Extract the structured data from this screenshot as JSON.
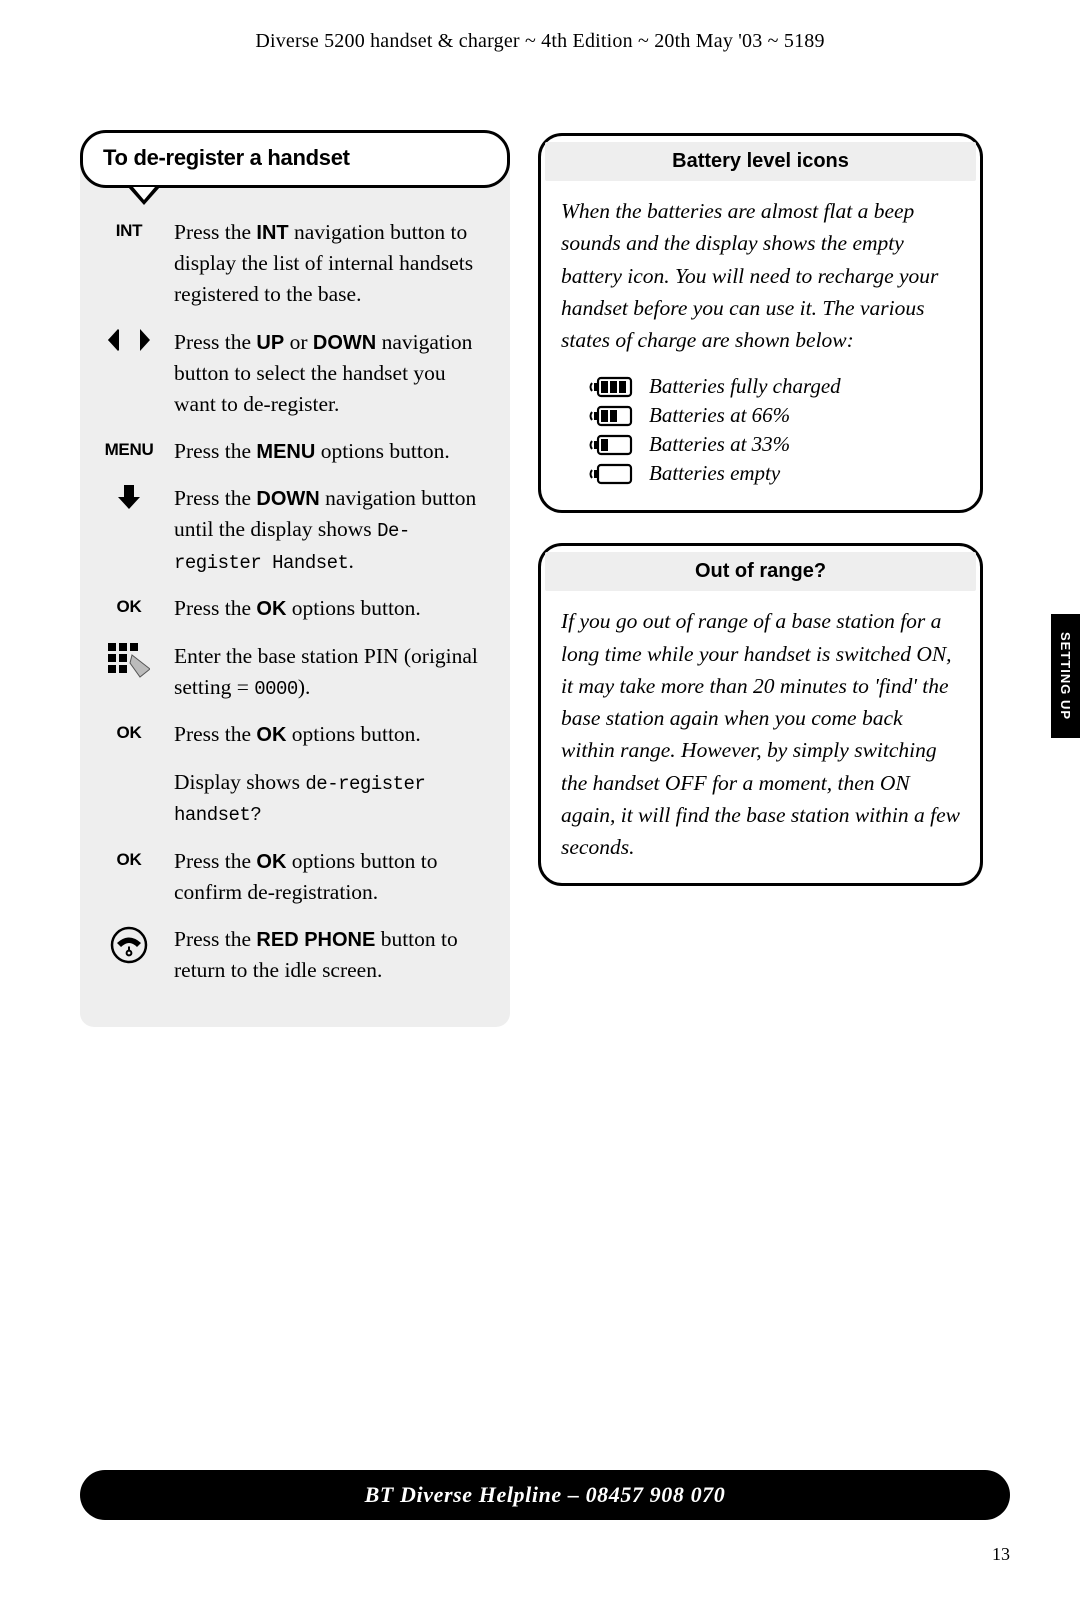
{
  "header": "Diverse 5200 handset & charger ~ 4th Edition ~ 20th May '03 ~ 5189",
  "left": {
    "title": "To de-register a handset",
    "steps": [
      {
        "label": "INT",
        "html": "Press the <span class='b'>INT</span> navigation button to display the list of internal handsets registered to the base."
      },
      {
        "icon": "updown",
        "html": "Press the <span class='b'>UP</span> or <span class='b'>DOWN</span> navigation button to select the handset you want to de-register."
      },
      {
        "label": "MENU",
        "html": "Press the <span class='b'>MENU</span> options button."
      },
      {
        "icon": "down",
        "html": "Press the <span class='b'>DOWN</span> navigation button until the display shows <span class='mono'>De-register Handset</span>."
      },
      {
        "label": "OK",
        "html": "Press the <span class='b'>OK</span> options button."
      },
      {
        "icon": "keypad",
        "html": "Enter the base station PIN (original setting = <span class='mono'>0000</span>)."
      },
      {
        "label": "OK",
        "html": "Press the <span class='b'>OK</span> options button."
      },
      {
        "label": "",
        "html": "Display shows <span class='mono'>de-register handset?</span>"
      },
      {
        "label": "OK",
        "html": "Press the <span class='b'>OK</span> options button to confirm de-registration."
      },
      {
        "icon": "phone",
        "html": "Press the <span class='b'>RED PHONE</span> button to return to the idle screen."
      }
    ]
  },
  "battery": {
    "title": "Battery level icons",
    "intro": "When the batteries are almost flat a beep sounds and the display shows the empty battery icon.  You will need to recharge your handset before you can use it. The various states of charge are shown below:",
    "levels": [
      {
        "bars": 3,
        "text": "Batteries fully charged"
      },
      {
        "bars": 2,
        "text": "Batteries at 66%"
      },
      {
        "bars": 1,
        "text": "Batteries at 33%"
      },
      {
        "bars": 0,
        "text": "Batteries empty"
      }
    ]
  },
  "range": {
    "title": "Out of range?",
    "body": "If you go out of range of a base station for a long time while your handset is switched ON, it may take more than 20 minutes to 'find' the base station again when you come back within range. However, by simply switching the handset OFF for a moment, then ON again, it will find the base station within a few seconds."
  },
  "sideTab": "SETTING UP",
  "footer": "BT Diverse Helpline – 08457 908 070",
  "pageNum": "13"
}
